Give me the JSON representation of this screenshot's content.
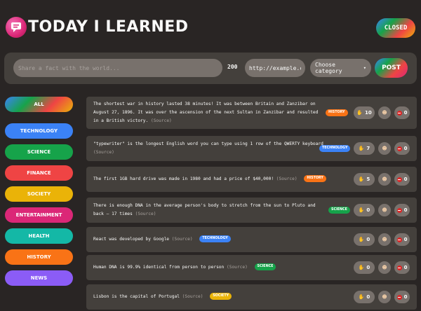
{
  "header": {
    "title": "TODAY I LEARNED",
    "close_label": "CLOSED"
  },
  "form": {
    "fact_placeholder": "Share a fact with the world...",
    "char_count": "200",
    "source_value": "http://example.co",
    "category_selected": "Choose category",
    "post_label": "POST"
  },
  "sidebar": {
    "items": [
      {
        "label": "All",
        "color": "gradient"
      },
      {
        "label": "Technology",
        "color": "#3b82f6"
      },
      {
        "label": "Science",
        "color": "#16a34a"
      },
      {
        "label": "Finance",
        "color": "#ef4444"
      },
      {
        "label": "Society",
        "color": "#eab308"
      },
      {
        "label": "Entertainment",
        "color": "#db2777"
      },
      {
        "label": "Health",
        "color": "#14b8a6"
      },
      {
        "label": "History",
        "color": "#f97316"
      },
      {
        "label": "News",
        "color": "#8b5cf6"
      }
    ]
  },
  "facts": [
    {
      "text": "The shortest war in history lasted 38 minutes! It was between Britain and Zanzibar on August 27, 1896. It was over the ascension of the next Sultan in Zanzibar and resulted in a British victory.",
      "source_label": "(Source)",
      "category": "History",
      "category_color": "#f97316",
      "votes_interesting": "10",
      "votes_mindblowing": "0",
      "votes_false": "0"
    },
    {
      "text": "\"typewriter\" is the longest English word you can type using 1 row of the QWERTY keyboard",
      "source_label": "(Source)",
      "category": "Technology",
      "category_color": "#3b82f6",
      "votes_interesting": "7",
      "votes_mindblowing": "0",
      "votes_false": "0"
    },
    {
      "text": "The first 1GB hard drive was made in 1980 and had a price of $40,000!",
      "source_label": "(Source)",
      "category": "History",
      "category_color": "#f97316",
      "votes_interesting": "5",
      "votes_mindblowing": "0",
      "votes_false": "0"
    },
    {
      "text": "There is enough DNA in the average person's body to stretch from the sun to Pluto and back — 17 times",
      "source_label": "(Source)",
      "category": "Science",
      "category_color": "#16a34a",
      "votes_interesting": "0",
      "votes_mindblowing": "0",
      "votes_false": "0"
    },
    {
      "text": "React was developed by Google",
      "source_label": "(Source)",
      "category": "Technology",
      "category_color": "#3b82f6",
      "votes_interesting": "0",
      "votes_mindblowing": "0",
      "votes_false": "0"
    },
    {
      "text": "Human DNA is 99.9% identical from person to person",
      "source_label": "(Source)",
      "category": "Science",
      "category_color": "#16a34a",
      "votes_interesting": "0",
      "votes_mindblowing": "0",
      "votes_false": "0"
    },
    {
      "text": "Lisbon is the capital of Portugal",
      "source_label": "(Source)",
      "category": "Society",
      "category_color": "#eab308",
      "votes_interesting": "0",
      "votes_mindblowing": "0",
      "votes_false": "0"
    }
  ]
}
